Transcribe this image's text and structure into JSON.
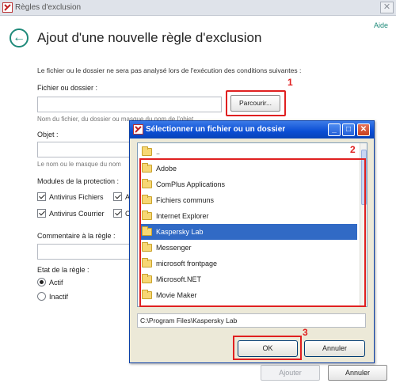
{
  "window": {
    "title": "Règles d'exclusion",
    "close_symbol": "✕"
  },
  "header": {
    "title": "Ajout d'une nouvelle règle d'exclusion",
    "help": "Aide"
  },
  "form": {
    "intro": "Le fichier ou le dossier ne sera pas analysé lors de l'exécution des conditions suivantes :",
    "file_label": "Fichier ou dossier :",
    "file_value": "",
    "browse_label": "Parcourir...",
    "file_hint": "Nom du fichier, du dossier ou masque du nom de l'objet",
    "object_label": "Objet :",
    "object_value": "",
    "object_hint": "Le nom ou le masque du nom",
    "modules_label": "Modules de la protection :",
    "modules": [
      {
        "label": "Antivirus Fichiers",
        "checked": true
      },
      {
        "label": "A",
        "checked": true
      },
      {
        "label": "Antivirus Courrier",
        "checked": true
      },
      {
        "label": "C",
        "checked": true
      }
    ],
    "comment_label": "Commentaire à la règle :",
    "comment_value": "",
    "state_label": "Etat de la règle :",
    "states": [
      {
        "label": "Actif",
        "selected": true
      },
      {
        "label": "Inactif",
        "selected": false
      }
    ],
    "add_label": "Ajouter",
    "cancel_label": "Annuler"
  },
  "dialog": {
    "title": "Sélectionner un fichier ou un dossier",
    "folders": [
      {
        "name": "..",
        "selected": false
      },
      {
        "name": "Adobe",
        "selected": false
      },
      {
        "name": "ComPlus Applications",
        "selected": false
      },
      {
        "name": "Fichiers communs",
        "selected": false
      },
      {
        "name": "Internet Explorer",
        "selected": false
      },
      {
        "name": "Kaspersky Lab",
        "selected": true
      },
      {
        "name": "Messenger",
        "selected": false
      },
      {
        "name": "microsoft frontpage",
        "selected": false
      },
      {
        "name": "Microsoft.NET",
        "selected": false
      },
      {
        "name": "Movie Maker",
        "selected": false
      }
    ],
    "path_value": "C:\\Program Files\\Kaspersky Lab",
    "ok_label": "OK",
    "cancel_label": "Annuler",
    "minimize_symbol": "_",
    "maximize_symbol": "□",
    "close_symbol": "✕"
  },
  "markers": {
    "step1": "1",
    "step2": "2",
    "step3": "3"
  },
  "colors": {
    "accent": "#1f8a7a",
    "highlight": "#e02020",
    "selection": "#316ac5",
    "dialog_title": "#0a4dd4"
  }
}
